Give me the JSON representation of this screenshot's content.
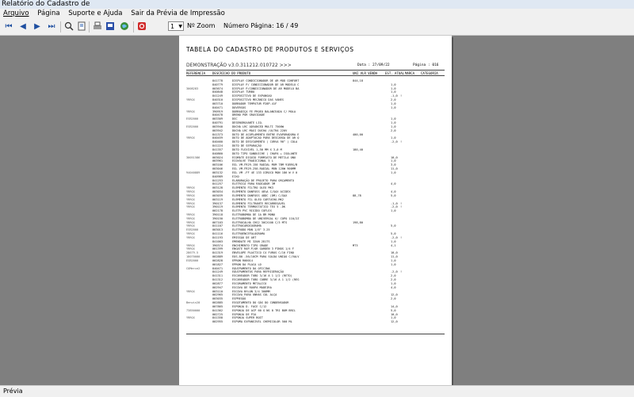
{
  "window": {
    "title": "Relatório do Cadastro de"
  },
  "menu": [
    "Arquivo",
    "Página",
    "Suporte e Ajuda",
    "Sair da Prévia de Impressão"
  ],
  "toolbar": {
    "icons": [
      "first-page-icon",
      "prev-page-icon",
      "next-page-icon",
      "last-page-icon",
      "zoom-icon",
      "page-setup-icon",
      "print-icon",
      "export-icon",
      "web-icon",
      "close-preview-icon"
    ],
    "zoom_value": "1",
    "zoom_label": "Nº Zoom",
    "page_label": "Número Página: 16 / 49"
  },
  "report": {
    "title": "TABELA DO CADASTRO DE PRODUTOS E SERVIÇOS",
    "subtitle": "DEMONSTRAÇÃO v3.0.311212.010722 >>>",
    "date": "Data :  27/09/22",
    "page": "Página :  016",
    "col_ref": "REFERENCIA",
    "col_desc": "DESCRICAO DO PRODUTO",
    "col_vlr": "UNI VLR VENDA",
    "col_est": "EST. ATUAL",
    "col_marca": "MARCA",
    "col_cat": "CATEGORIA",
    "rows": [
      {
        "ref": "",
        "cod": "841778",
        "desc": "DISPLAY CONDICIONADOR DE AR MOD CONFORT",
        "vlr": "844,18",
        "est": "",
        "marca": ""
      },
      {
        "ref": "",
        "cod": "840779",
        "desc": "DISPLAY P/ CONDICIONADOR DE AR MODELO C",
        "vlr": "",
        "est": "1,0",
        "marca": ""
      },
      {
        "ref": "3008283",
        "cod": "003674",
        "desc": "DISPLAY P/CONDICIONADOR DE AR MODELO BA",
        "vlr": "",
        "est": "1,0",
        "marca": ""
      },
      {
        "ref": "",
        "cod": "840848",
        "desc": "DISPLAY TURBO",
        "vlr": "",
        "est": "1,0",
        "marca": ""
      },
      {
        "ref": "",
        "cod": "841249",
        "desc": "DISPOSITIVO DE EXPANSAO",
        "vlr": "",
        "est": "-1,0",
        "marca": "!"
      },
      {
        "ref": "YRRGX",
        "cod": "840310",
        "desc": "DISPOSITIVO MECÂNICO DAS VANES",
        "vlr": "",
        "est": "2,0",
        "marca": ""
      },
      {
        "ref": "",
        "cod": "003710",
        "desc": "DOBRADOR TEMPATUR P28P-41F",
        "vlr": "",
        "est": "1,0",
        "marca": ""
      },
      {
        "ref": "",
        "cod": "840471",
        "desc": "DOVERSOS",
        "vlr": "",
        "est": "1,0",
        "marca": ""
      },
      {
        "ref": "YRRGX",
        "cod": "390919",
        "desc": "DOBRADIÇA FE PROEO BALANCEADA C/ MOLA",
        "vlr": "",
        "est": "",
        "marca": ""
      },
      {
        "ref": "",
        "cod": "840478",
        "desc": "DRENO POR GRAVIDADE",
        "vlr": "",
        "est": "",
        "marca": ""
      },
      {
        "ref": "ESB2000",
        "cod": "003309",
        "desc": "DSC",
        "vlr": "",
        "est": "1,0",
        "marca": ""
      },
      {
        "ref": "",
        "cod": "840791",
        "desc": "DESENGRUXANTE LIQ.",
        "vlr": "",
        "est": "1,0",
        "marca": ""
      },
      {
        "ref": "ESB2000",
        "cod": "003940",
        "desc": "DUCHA LRC ADVANCED MULTI 7500W",
        "vlr": "",
        "est": "1,0",
        "marca": ""
      },
      {
        "ref": "",
        "cod": "003942",
        "desc": "DUCHA LRC MAXI DUCHA /ULTRA 220V",
        "vlr": "",
        "est": "2,0",
        "marca": ""
      },
      {
        "ref": "",
        "cod": "841373",
        "desc": "DUTO DE ACOPLAMENTO ENTRE EVAPORADORA E",
        "vlr": "400,00",
        "est": "",
        "marca": ""
      },
      {
        "ref": "YRRGX",
        "cod": "840459",
        "desc": "DUTO DE ADAPTACAO PARA DESCARGA DE AR Q",
        "vlr": "",
        "est": "1,0",
        "marca": ""
      },
      {
        "ref": "",
        "cod": "840460",
        "desc": "DUTO DE DESVIAMENTO ( CURVA 90° ) COLA",
        "vlr": "",
        "est": "-2,0",
        "marca": "!"
      },
      {
        "ref": "",
        "cod": "841224",
        "desc": "DUTO DE SEPARAÇÃO",
        "vlr": "",
        "est": "",
        "marca": ""
      },
      {
        "ref": "",
        "cod": "841357",
        "desc": "DUTO FLEXIVEL 1,50 MM X 3,0 M",
        "vlr": "180,40",
        "est": "",
        "marca": ""
      },
      {
        "ref": "",
        "cod": "840860",
        "desc": "DUTO TIPO SANDUICHE ( CHAPA + ISOLANTE",
        "vlr": "",
        "est": "",
        "marca": ""
      },
      {
        "ref": "30051586",
        "cod": "003024",
        "desc": "ECOMATE DIGUIO FORMIATO DE METILA ONU",
        "vlr": "",
        "est": "10,0",
        "marca": ""
      },
      {
        "ref": "",
        "cod": "003961",
        "desc": "ECOVOLVE TRADICIONAL 5 L",
        "vlr": "",
        "est": "1,0",
        "marca": ""
      },
      {
        "ref": "",
        "cod": "003106",
        "desc": "EGL VM-FR29-150 RADIAL MOM 7BM 91BRS/B",
        "vlr": "",
        "est": "3,0",
        "marca": ""
      },
      {
        "ref": "",
        "cod": "003046",
        "desc": "EGL VM-FR29-250-RADIAL MON 120W 900MM",
        "vlr": "",
        "est": "11,0",
        "marca": ""
      },
      {
        "ref": "94040889",
        "cod": "003132",
        "desc": "EGL VM -FF 4E 133 XIROCO MON 186 W V 0",
        "vlr": "",
        "est": "1,0",
        "marca": ""
      },
      {
        "ref": "",
        "cod": "840989",
        "desc": "EIXO",
        "vlr": "",
        "est": "",
        "marca": ""
      },
      {
        "ref": "",
        "cod": "841253",
        "desc": "ELABORAÇÃO DE PROJETO PARA ORÇAMENTO",
        "vlr": "",
        "est": "",
        "marca": ""
      },
      {
        "ref": "",
        "cod": "841257",
        "desc": "ELETRICA PARA RADIADOR 3M",
        "vlr": "",
        "est": "4,0",
        "marca": ""
      },
      {
        "ref": "YRRGX",
        "cod": "003128",
        "desc": "ELEMENTO FILTRO OLEO MK3",
        "vlr": "",
        "est": "",
        "marca": ""
      },
      {
        "ref": "YRRGX",
        "cod": "003034",
        "desc": "ELEMENTO DANFOSS 48%A C/GAX ACIDEX",
        "vlr": "",
        "est": "4,0",
        "marca": ""
      },
      {
        "ref": "YRRGX",
        "cod": "003039",
        "desc": "ELEMENTO DANFOSS 48DC (DM) C/GAX",
        "vlr": "88,78",
        "est": "5,0",
        "marca": ""
      },
      {
        "ref": "YRRGX",
        "cod": "003119",
        "desc": "ELEMENTO FIL OLEO CARTUCHO-MK2",
        "vlr": "",
        "est": "",
        "marca": ""
      },
      {
        "ref": "YRRGX",
        "cod": "390137",
        "desc": "ELEMENTO FILTRANTE RECARREGAVEL",
        "vlr": "",
        "est": "-1,0",
        "marca": "!"
      },
      {
        "ref": "YRRGX",
        "cod": "390119",
        "desc": "ELEMENTO TERMOSTATICO TEX 5 -DK",
        "vlr": "",
        "est": "-2,0",
        "marca": "!"
      },
      {
        "ref": "",
        "cod": "002178",
        "desc": "ELETR PVC RIGIDO COFLEX",
        "vlr": "",
        "est": "1,0",
        "marca": ""
      },
      {
        "ref": "YRRGX",
        "cod": "390118",
        "desc": "ELETROBOMBA DE 1A BR MONO",
        "vlr": "",
        "est": "",
        "marca": ""
      },
      {
        "ref": "YRRGX",
        "cod": "390150",
        "desc": "ELETROBOMBA DE UNIVERSAL 6/ COPO 110/2Z",
        "vlr": "",
        "est": "",
        "marca": ""
      },
      {
        "ref": "YRRGX",
        "cod": "007103",
        "desc": "ELETROCALHA CHS2 30CX100 C/3 MTS",
        "vlr": "198,80",
        "est": "",
        "marca": ""
      },
      {
        "ref": "YRRGX",
        "cod": "841107",
        "desc": "ELETROCARDIOGRAMA",
        "vlr": "",
        "est": "5,0",
        "marca": ""
      },
      {
        "ref": "ESB2000",
        "cod": "003013",
        "desc": "ELETRODO MAN 1/8\" 3.25",
        "vlr": "",
        "est": "",
        "marca": ""
      },
      {
        "ref": "YRRGX",
        "cod": "841116",
        "desc": "ELETROENCEFALOGRAMA",
        "vlr": "",
        "est": "5,0",
        "marca": ""
      },
      {
        "ref": "YRRGX",
        "cod": "841193",
        "desc": "EMISSÃO DE ART",
        "vlr": "",
        "est": "-2,0",
        "marca": "!"
      },
      {
        "ref": "",
        "cod": "841003",
        "desc": "EMENDATE MI 32UN 2D1TS",
        "vlr": "",
        "est": "1,0",
        "marca": ""
      },
      {
        "ref": "YRRGX",
        "cod": "390374",
        "desc": "ENCHIMENTO TIPO GRADE",
        "vlr": "MT3",
        "est": "4,1",
        "marca": ""
      },
      {
        "ref": "YRRGX",
        "cod": "001399",
        "desc": "ENGATE RAP.P/AR GARDEN 3 PINOS 1/4 F",
        "vlr": "",
        "est": "",
        "marca": ""
      },
      {
        "ref": "28679-5",
        "cod": "841319",
        "desc": "ENVELOPE PLASTICO C4 FUROS C/10 FINO",
        "vlr": "",
        "est": "10,0",
        "marca": ""
      },
      {
        "ref": "18070000",
        "cod": "002889",
        "desc": "EOS-80 -56/10CM PARA SOLDA UNIÃO C/VALV",
        "vlr": "",
        "est": "11,0",
        "marca": ""
      },
      {
        "ref": "ESB2000",
        "cod": "002828",
        "desc": "EPRON  R00014",
        "vlr": "",
        "est": "1,0",
        "marca": ""
      },
      {
        "ref": "",
        "cod": "001827",
        "desc": "EPRON DA PLACA LD",
        "vlr": "",
        "est": "1,0",
        "marca": ""
      },
      {
        "ref": "COMerce2",
        "cod": "840471",
        "desc": "EQUIPAMENTO DA OFICINA",
        "vlr": "",
        "est": "",
        "marca": ""
      },
      {
        "ref": "",
        "cod": "841249",
        "desc": "EQUIPAMENTOS PARA REFRIGERAÇÃO",
        "vlr": "",
        "est": "-2,0",
        "marca": "!"
      },
      {
        "ref": "",
        "cod": "841311",
        "desc": "ESCAREADOR TUBO 3/16 A 1 1/2 (RETO)",
        "vlr": "",
        "est": "2,0",
        "marca": ""
      },
      {
        "ref": "",
        "cod": "841312",
        "desc": "ESCAREADOR TUBO COBRE 3/16 A 1 1/2 (REG",
        "vlr": "",
        "est": "2,0",
        "marca": ""
      },
      {
        "ref": "",
        "cod": "002877",
        "desc": "ESCORAMENTO METALICO",
        "vlr": "",
        "est": "1,0",
        "marca": ""
      },
      {
        "ref": "",
        "cod": "002947",
        "desc": "ESCOVA DE ROUPA MADEIRA",
        "vlr": "",
        "est": "4,0",
        "marca": ""
      },
      {
        "ref": "YRRGX",
        "cod": "003110",
        "desc": "ESCOVA NYLON 3/4 300MM",
        "vlr": "",
        "est": "",
        "marca": ""
      },
      {
        "ref": "",
        "cod": "002965",
        "desc": "ESCOVA PARA UNHAS COL ALÇA",
        "vlr": "",
        "est": "12,0",
        "marca": ""
      },
      {
        "ref": "",
        "cod": "003035",
        "desc": "ESPREGÃO",
        "vlr": "",
        "est": "2,0",
        "marca": ""
      },
      {
        "ref": "Benvin20",
        "cod": "002885",
        "desc": "ESGOTAMENTO DO GÁS DO CONDENSADOR",
        "vlr": "",
        "est": "",
        "marca": ""
      },
      {
        "ref": "",
        "cod": "007865",
        "desc": "ESPONJA D. FACE C/12",
        "vlr": "",
        "est": "14,0",
        "marca": ""
      },
      {
        "ref": "73850000",
        "cod": "841362",
        "desc": "ESPONJA DE ACP 60 G NS 8 TRI BOM BRIL",
        "vlr": "",
        "est": "5,0",
        "marca": ""
      },
      {
        "ref": "",
        "cod": "002725",
        "desc": "ESPONJA DE PIA",
        "vlr": "",
        "est": "10,0",
        "marca": ""
      },
      {
        "ref": "YRRGX",
        "cod": "841358",
        "desc": "ESPONJA SUPER BOIT",
        "vlr": "",
        "est": "1,0",
        "marca": ""
      },
      {
        "ref": "",
        "cod": "002955",
        "desc": "ESPUMA EXPANSIVEL CHEMICOLOR 500 ML",
        "vlr": "",
        "est": "12,0",
        "marca": ""
      }
    ]
  },
  "status": {
    "text": "Prévia"
  }
}
